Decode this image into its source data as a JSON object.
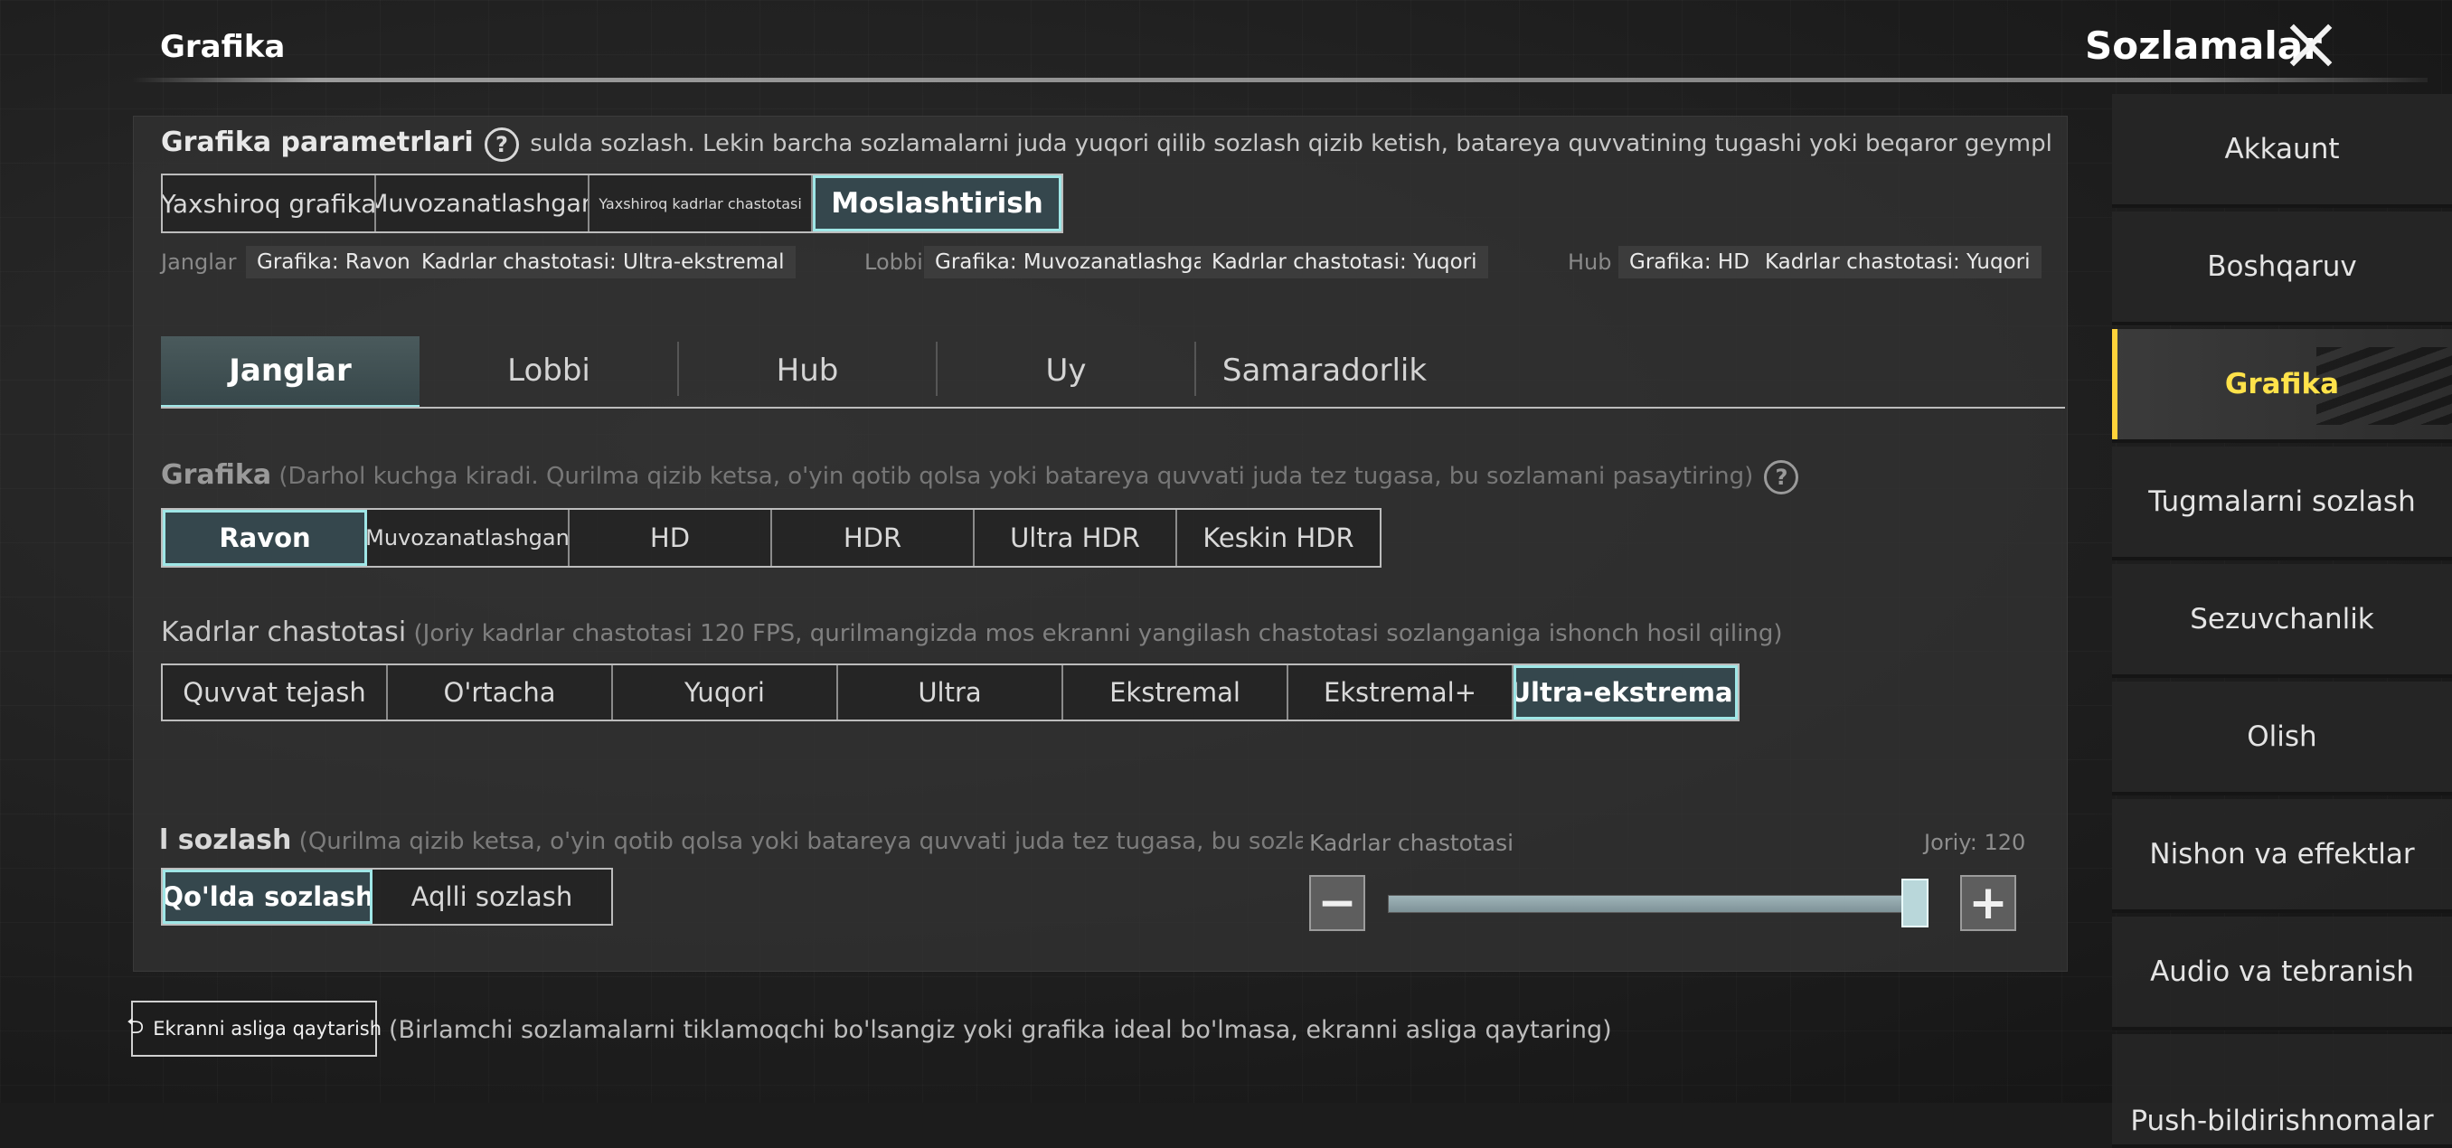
{
  "header": {
    "section_title": "Grafika",
    "settings_title": "Sozlamalar"
  },
  "graphics_params": {
    "title": "Grafika parametrlari",
    "help": "?",
    "description": "sulda sozlash. Lekin barcha sozlamalarni juda yuqori qilib sozlash qizib ketish, batareya quvvatining tugashi yoki beqaror geympley kabi unumdorlik muamm",
    "presets": [
      {
        "label": "Yaxshiroq grafika"
      },
      {
        "label": "Muvozanatlashgan"
      },
      {
        "label": "Yaxshiroq kadrlar chastotasi"
      },
      {
        "label": "Moslashtirish"
      }
    ],
    "summary": {
      "janglar": {
        "label": "Janglar",
        "graphics": "Grafika: Ravon",
        "fps": "Kadrlar chastotasi: Ultra-ekstremal"
      },
      "lobbi": {
        "label": "Lobbi",
        "graphics": "Grafika: Muvozanatlashgan",
        "fps": "Kadrlar chastotasi: Yuqori"
      },
      "hub": {
        "label": "Hub",
        "graphics": "Grafika: HD",
        "fps": "Kadrlar chastotasi: Yuqori"
      }
    }
  },
  "tabs": [
    {
      "label": "Janglar"
    },
    {
      "label": "Lobbi"
    },
    {
      "label": "Hub"
    },
    {
      "label": "Uy"
    },
    {
      "label": "Samaradorlik"
    }
  ],
  "grafika": {
    "title": "Grafika",
    "note": "(Darhol kuchga kiradi. Qurilma qizib ketsa, o'yin qotib qolsa yoki batareya quvvati juda tez tugasa, bu sozlamani pasaytiring)",
    "help": "?",
    "options": [
      {
        "label": "Ravon"
      },
      {
        "label": "Muvozanatlashgan"
      },
      {
        "label": "HD"
      },
      {
        "label": "HDR"
      },
      {
        "label": "Ultra HDR"
      },
      {
        "label": "Keskin HDR"
      }
    ]
  },
  "frame_rate": {
    "title": "Kadrlar chastotasi",
    "note": "(Joriy kadrlar chastotasi 120 FPS, qurilmangizda mos ekranni yangilash chastotasi sozlanganiga ishonch hosil qiling)",
    "options": [
      {
        "label": "Quvvat tejash"
      },
      {
        "label": "O'rtacha"
      },
      {
        "label": "Yuqori"
      },
      {
        "label": "Ultra"
      },
      {
        "label": "Ekstremal"
      },
      {
        "label": "Ekstremal+"
      },
      {
        "label": "Ultra-ekstremal"
      }
    ]
  },
  "adjust": {
    "title": "l sozlash",
    "note": "(Qurilma qizib ketsa, o'yin qotib qolsa yoki batareya quvvati juda tez tugasa, bu sozlamani pasaytiring",
    "options": [
      {
        "label": "Qo'lda sozlash"
      },
      {
        "label": "Aqlli sozlash"
      }
    ]
  },
  "fps_slider": {
    "label": "Kadrlar chastotasi",
    "current": "Joriy: 120",
    "minus": "−",
    "plus": "+",
    "level": 1.0
  },
  "reset": {
    "icon": "⮌",
    "label": "Ekranni asliga qaytarish",
    "note": "(Birlamchi sozlamalarni tiklamoqchi bo'lsangiz yoki grafika ideal bo'lmasa, ekranni asliga qaytaring)"
  },
  "nav": [
    {
      "label": "Akkaunt"
    },
    {
      "label": "Boshqaruv"
    },
    {
      "label": "Grafika"
    },
    {
      "label": "Tugmalarni sozlash"
    },
    {
      "label": "Sezuvchanlik"
    },
    {
      "label": "Olish"
    },
    {
      "label": "Nishon va effektlar"
    },
    {
      "label": "Audio va tebranish"
    },
    {
      "label": "Push-bildirishnomalar"
    }
  ],
  "colors": {
    "accent": "#9fe7e7",
    "nav_active": "#ffe24a"
  }
}
